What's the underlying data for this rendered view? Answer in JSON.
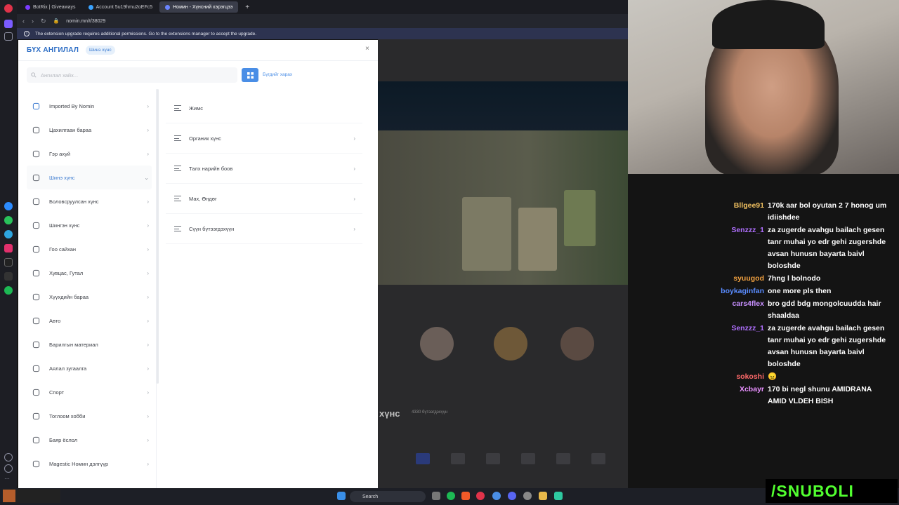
{
  "browser": {
    "tabs": [
      {
        "label": "BotRix | Giveaways",
        "active": false,
        "color": "#7b3cff"
      },
      {
        "label": "Account 5u19hmu2oEFc5",
        "active": false,
        "color": "#3aa3ff"
      },
      {
        "label": "Номин - Хүнсний хэрэгцээ",
        "active": true,
        "color": "#6a84ff"
      }
    ],
    "url": "nomin.mn/t/38029",
    "notice": "The extension upgrade requires additional permissions. Go to the extensions manager to accept the upgrade."
  },
  "modal": {
    "title": "БҮХ АНГИЛАЛ",
    "chip": "Шинэ хүнс",
    "close": "×",
    "search_placeholder": "Ангилал хайх...",
    "view_all": "Бүгдийг харах",
    "categories": [
      {
        "label": "Imported By Nomin",
        "icon": "star-icon",
        "active": false
      },
      {
        "label": "Цахилгаан бараа",
        "icon": "monitor-icon",
        "active": false
      },
      {
        "label": "Гэр ахуй",
        "icon": "home-icon",
        "active": false
      },
      {
        "label": "Шинэ хүнс",
        "icon": "apple-icon",
        "active": true
      },
      {
        "label": "Боловсруулсан хүнс",
        "icon": "snowflake-icon",
        "active": false
      },
      {
        "label": "Шингэн хүнс",
        "icon": "bottle-icon",
        "active": false
      },
      {
        "label": "Гоо сайхан",
        "icon": "cosmetics-icon",
        "active": false
      },
      {
        "label": "Хувцас, Гутал",
        "icon": "shirt-icon",
        "active": false
      },
      {
        "label": "Хүүхдийн бараа",
        "icon": "baby-icon",
        "active": false
      },
      {
        "label": "Авто",
        "icon": "car-icon",
        "active": false
      },
      {
        "label": "Барилгын материал",
        "icon": "building-icon",
        "active": false
      },
      {
        "label": "Аялал зугаалга",
        "icon": "tent-icon",
        "active": false
      },
      {
        "label": "Спорт",
        "icon": "ball-icon",
        "active": false
      },
      {
        "label": "Тоглоом хобби",
        "icon": "gamepad-icon",
        "active": false
      },
      {
        "label": "Баяр ёслол",
        "icon": "gift-icon",
        "active": false
      },
      {
        "label": "Magestic Номин дэлгүүр",
        "icon": "store-icon",
        "active": false
      }
    ],
    "subcategories": [
      {
        "label": "Жимс",
        "arrow": false
      },
      {
        "label": "Органик хүнс",
        "arrow": true
      },
      {
        "label": "Талх нарийн боов",
        "arrow": true
      },
      {
        "label": "Мах, Өндөг",
        "arrow": true
      },
      {
        "label": "Сүүн бүтээгдэхүүн",
        "arrow": true
      }
    ]
  },
  "background_page": {
    "section_heading": "хүнс",
    "section_count": "4330 бүтээгдэхүүн"
  },
  "chat": [
    {
      "user": "Bllgee91",
      "color": "#f0c060",
      "text": "170k aar bol oyutan 2 7 honog um idiishdee"
    },
    {
      "user": "Senzzz_1",
      "color": "#b070ff",
      "text": "za zugerde avahgu bailach gesen tanr muhai yo edr gehi zugershde avsan hunusn bayarta baivl boloshde"
    },
    {
      "user": "syuugod",
      "color": "#f0a040",
      "text": "7hng l bolnodo"
    },
    {
      "user": "boykaginfan",
      "color": "#5a8cff",
      "text": "one more pls then"
    },
    {
      "user": "cars4flex",
      "color": "#c890ff",
      "text": "bro gdd bdg mongolcuudda hair shaaldaa"
    },
    {
      "user": "Senzzz_1",
      "color": "#b070ff",
      "text": "za zugerde avahgu bailach gesen tanr muhai yo edr gehi zugershde avsan hunusn bayarta baivl boloshde"
    },
    {
      "user": "sokoshi",
      "color": "#ff6a6a",
      "text": "😠"
    },
    {
      "user": "Xcbayr",
      "color": "#e890ff",
      "text": "170 bi negl shunu AMIDRANA AMID VLDEH BISH"
    }
  ],
  "taskbar": {
    "search": "Search"
  },
  "overlay": {
    "brand": "/SNUBOLI"
  },
  "colors": {
    "accent": "#3b7ad0",
    "button": "#4a8ee6"
  }
}
